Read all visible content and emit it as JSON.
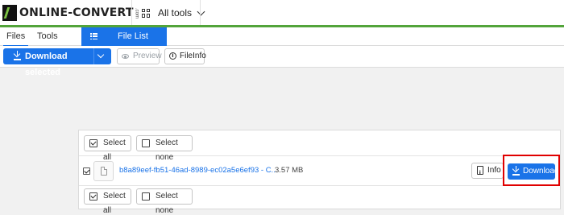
{
  "header": {
    "logo_text": "ONLINE-CONVERT",
    "logo_tld": ".com",
    "all_tools_label": "All tools"
  },
  "tabs": {
    "files": "Files",
    "tools": "Tools",
    "file_list": "File List"
  },
  "toolbar": {
    "download_selected": "Download selected",
    "preview": "Preview",
    "fileinfo": "FileInfo"
  },
  "selection": {
    "select_all": "Select all",
    "select_none": "Select none"
  },
  "file": {
    "name": "b8a89eef-fb51-46ad-8989-ec02a5e6ef93 - C...",
    "size": "3.57 MB",
    "checked": true,
    "info_label": "Info",
    "download_label": "Download"
  },
  "colors": {
    "accent": "#1a73e8",
    "brand_green": "#52a43a",
    "highlight": "#e00000"
  },
  "icons": {
    "logo": "online-convert-logo",
    "all_tools": "grid-icon",
    "file_list": "list-icon",
    "download": "download-icon",
    "preview": "eye-icon",
    "fileinfo": "info-icon",
    "file": "file-icon",
    "info": "file-info-icon"
  }
}
